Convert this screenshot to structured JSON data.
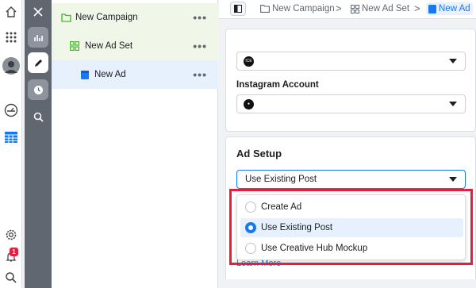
{
  "rail": {
    "icons": [
      "home-icon",
      "apps-grid-icon",
      "profile-avatar",
      "dashboard-gauge-icon",
      "ads-manager-table-icon",
      "settings-gear-icon",
      "notifications-bell-icon",
      "search-icon"
    ],
    "notification_count": "1"
  },
  "strip": {
    "icons": [
      "close-icon",
      "charts-icon",
      "edit-pencil-icon",
      "history-clock-icon",
      "search-zoom-icon"
    ]
  },
  "tree": {
    "campaign": {
      "label": "New Campaign",
      "menu": "•••"
    },
    "adset": {
      "label": "New Ad Set",
      "menu": "•••"
    },
    "ad": {
      "label": "New Ad",
      "menu": "•••"
    }
  },
  "breadcrumb": {
    "items": [
      "New Campaign",
      "New Ad Set",
      "New Ad"
    ],
    "separator": ">"
  },
  "identity": {
    "page_select_avatar": "ICE",
    "instagram_label": "Instagram Account",
    "instagram_avatar": "●"
  },
  "ad_setup": {
    "title": "Ad Setup",
    "selected_value": "Use Existing Post",
    "options": [
      "Create Ad",
      "Use Existing Post",
      "Use Creative Hub Mockup"
    ],
    "selected_index": 1,
    "learn_more": "Learn More"
  },
  "colors": {
    "accent": "#1877f2",
    "highlight_border": "#e41e3f",
    "tree_green_bg": "#f0f7e9",
    "tree_blue_bg": "#e7f0fd"
  }
}
